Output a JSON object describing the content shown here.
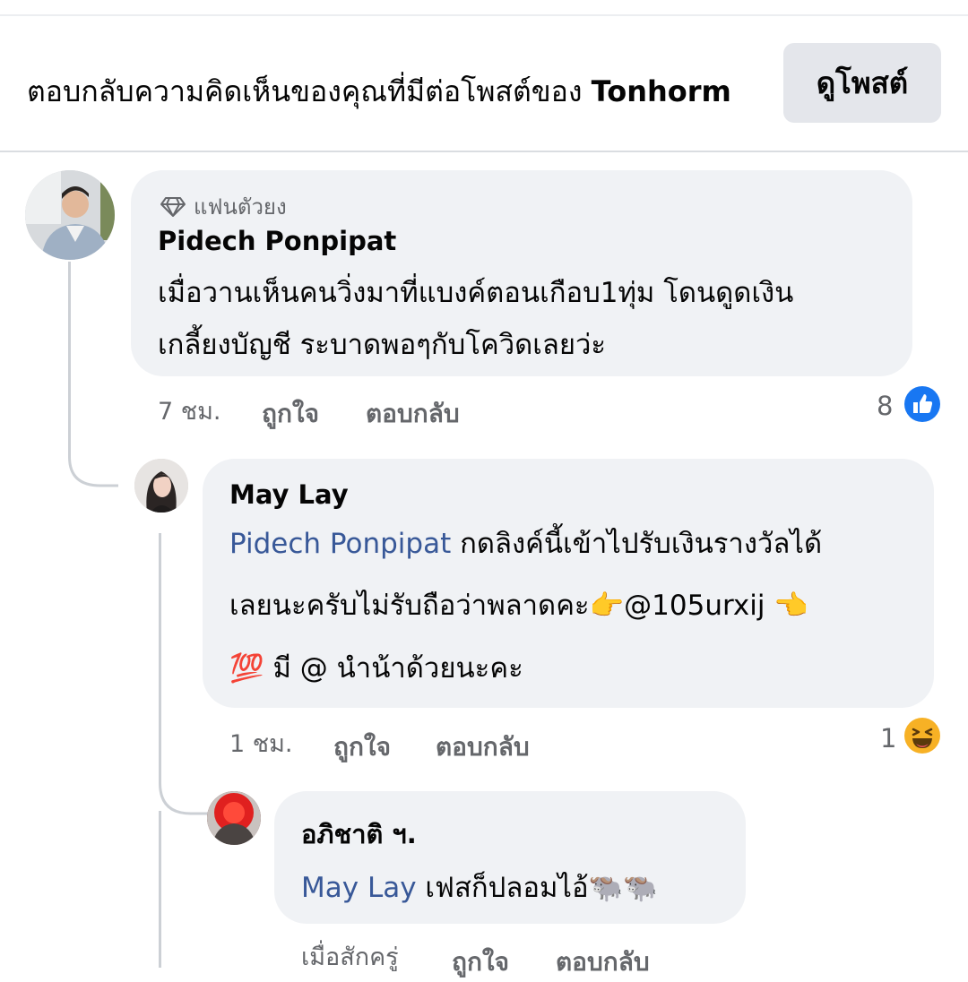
{
  "header": {
    "reply_prefix": "ตอบกลับความคิดเห็นของคุณที่มีต่อโพสต์ของ",
    "post_owner": "Tonhorm",
    "view_post_label": "ดูโพสต์"
  },
  "comments": [
    {
      "badge_icon": "diamond-icon",
      "badge": "แฟนตัวยง",
      "author": "Pidech Ponpipat",
      "lines": [
        "เมื่อวานเห็นคนวิ่งมาที่แบงค์ตอนเกือบ1ทุ่ม โดนดูดเงิน",
        "เกลี้ยงบัญชี ระบาดพอๆกับโควิดเลยว่ะ"
      ],
      "time": "7 ชม.",
      "like_label": "ถูกใจ",
      "reply_label": "ตอบกลับ",
      "reaction_count": "8",
      "reaction_icon": "like-icon"
    },
    {
      "author": "May Lay",
      "mention": "Pidech Ponpipat",
      "line1_rest": " กดลิงค์นี้เข้าไปรับเงินรางวัลได้",
      "line2": "เลยนะครับไม่รับถือว่าพลาดคะ👉@105urxij 👈",
      "line3": "💯 มี @ นำน้าด้วยนะคะ",
      "time": "1 ชม.",
      "like_label": "ถูกใจ",
      "reply_label": "ตอบกลับ",
      "reaction_count": "1",
      "reaction_icon": "haha-icon"
    },
    {
      "author": "อภิชาติ ฯ.",
      "mention": "May Lay",
      "text_rest": " เฟสก็ปลอมไอ้🐃🐃",
      "time": "เมื่อสักครู่",
      "like_label": "ถูกใจ",
      "reply_label": "ตอบกลับ"
    }
  ],
  "colors": {
    "bubble": "#f0f2f5",
    "mention": "#385898",
    "meta": "#65676b",
    "like_blue": "#1877f2",
    "haha_yellow": "#f7b125"
  }
}
